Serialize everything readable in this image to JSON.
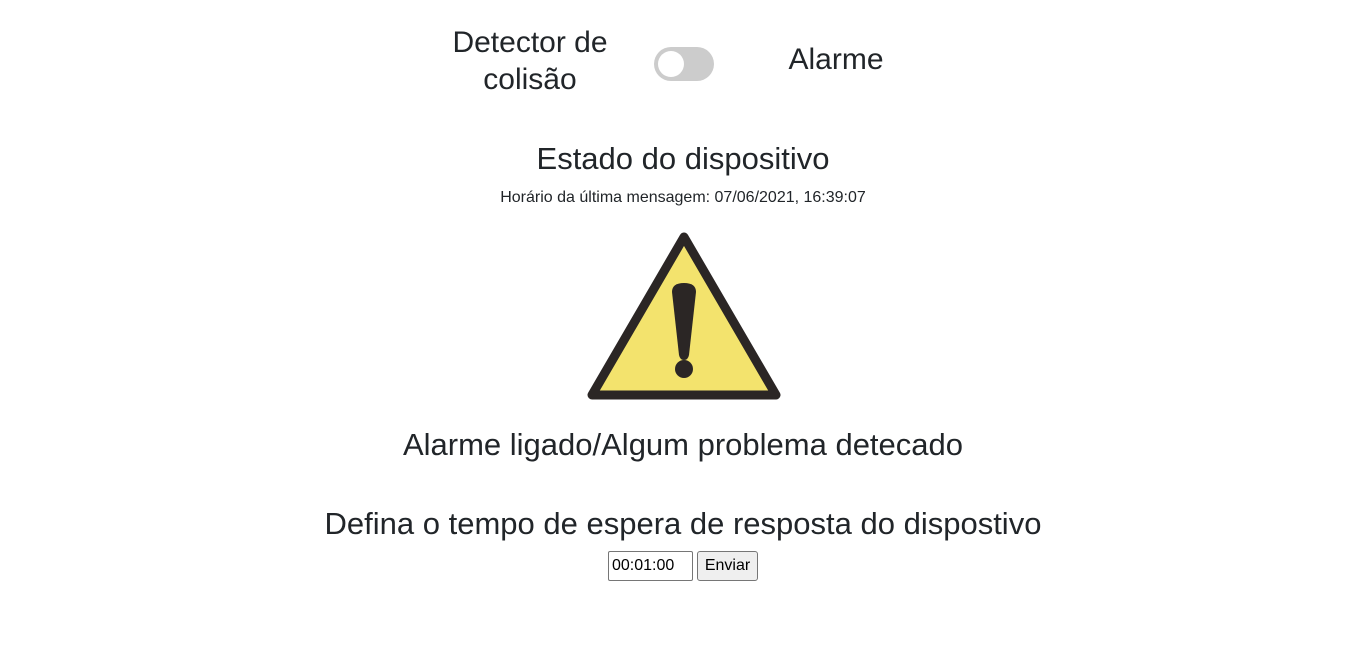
{
  "mode": {
    "left_label": "Detector de colisão",
    "right_label": "Alarme",
    "toggle_checked": false
  },
  "status": {
    "title": "Estado do dispositivo",
    "last_message": "Horário da última mensagem: 07/06/2021, 16:39:07",
    "icon": "warning-icon",
    "text": "Alarme ligado/Algum problema detecado"
  },
  "timeout": {
    "title": "Defina o tempo de espera de resposta do dispostivo",
    "value": "00:01:00",
    "button_label": "Enviar"
  },
  "colors": {
    "warning_fill": "#F3E36D",
    "warning_stroke": "#2B2625",
    "toggle_off": "#CCCCCC",
    "text": "#212529"
  }
}
